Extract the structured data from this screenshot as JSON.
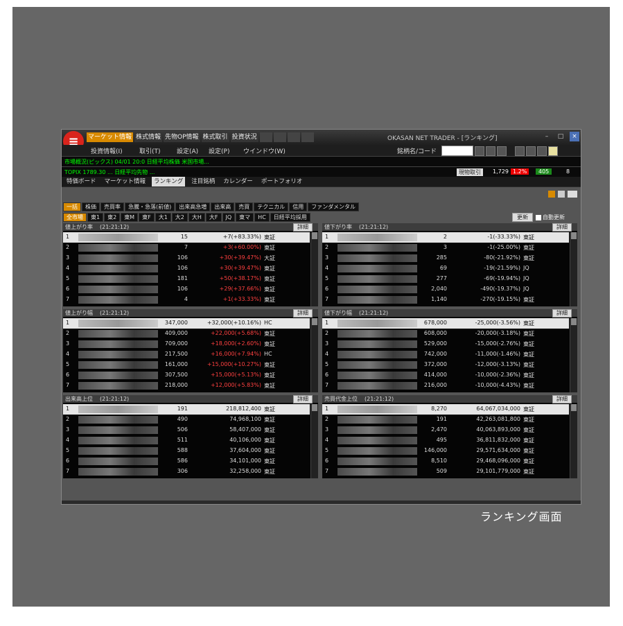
{
  "window": {
    "title": "OKASAN NET TRADER - [ランキング]"
  },
  "top_menu": [
    "マーケット情報",
    "株式情報",
    "先物OP情報",
    "株式取引",
    "投資状況"
  ],
  "menu_bar": [
    "投資情報(I)",
    "取引(T)",
    "設定(A)",
    "設定(P)",
    "ウインドウ(W)"
  ],
  "code_label": "銘柄名/コード",
  "ticker1": "市場概況(ピックス) 04/01 20:0 日経平均株価 米国市場...",
  "ticker2": "TOPIX 1789.30 ... 日経平均先物 ...",
  "status": {
    "kubun": "現物取引",
    "v1": "1,729",
    "v2": "1.2%",
    "v3": "405",
    "v4": "8"
  },
  "tabs": [
    "特価ボード",
    "マーケット情報",
    "ランキング",
    "注目銘柄",
    "カレンダー",
    "ポートフォリオ"
  ],
  "active_tab": "ランキング",
  "categories": [
    "一括",
    "株価",
    "売買率",
    "急騰・急落(前値)",
    "出来高急増",
    "出来高",
    "売買",
    "テクニカル",
    "信用",
    "ファンダメンタル"
  ],
  "markets": [
    "全市場",
    "東1",
    "東2",
    "東M",
    "東F",
    "大1",
    "大2",
    "大H",
    "大F",
    "JQ",
    "東マ",
    "HC",
    "日経平均採用"
  ],
  "update_label": "更新",
  "auto_label": "自動更新",
  "detail_label": "詳細",
  "panels": [
    {
      "title": "値上がり率",
      "time": "(21:21:12)",
      "rows": [
        {
          "rank": "1",
          "a": "15",
          "b": "+7(+83.33%)",
          "mkt": "東証"
        },
        {
          "rank": "2",
          "a": "7",
          "b": "+3(+60.00%)",
          "mkt": "東証"
        },
        {
          "rank": "3",
          "a": "106",
          "b": "+30(+39.47%)",
          "mkt": "大証"
        },
        {
          "rank": "4",
          "a": "106",
          "b": "+30(+39.47%)",
          "mkt": "東証"
        },
        {
          "rank": "5",
          "a": "181",
          "b": "+50(+38.17%)",
          "mkt": "東証"
        },
        {
          "rank": "6",
          "a": "106",
          "b": "+29(+37.66%)",
          "mkt": "東証"
        },
        {
          "rank": "7",
          "a": "4",
          "b": "+1(+33.33%)",
          "mkt": "東証"
        }
      ]
    },
    {
      "title": "値下がり率",
      "time": "(21:21:12)",
      "rows": [
        {
          "rank": "1",
          "a": "2",
          "b": "-1(-33.33%)",
          "mkt": "東証"
        },
        {
          "rank": "2",
          "a": "3",
          "b": "-1(-25.00%)",
          "mkt": "東証"
        },
        {
          "rank": "3",
          "a": "285",
          "b": "-80(-21.92%)",
          "mkt": "東証"
        },
        {
          "rank": "4",
          "a": "69",
          "b": "-19(-21.59%)",
          "mkt": "JQ"
        },
        {
          "rank": "5",
          "a": "277",
          "b": "-69(-19.94%)",
          "mkt": "JQ"
        },
        {
          "rank": "6",
          "a": "2,040",
          "b": "-490(-19.37%)",
          "mkt": "JQ"
        },
        {
          "rank": "7",
          "a": "1,140",
          "b": "-270(-19.15%)",
          "mkt": "東証"
        }
      ]
    },
    {
      "title": "値上がり幅",
      "time": "(21:21:12)",
      "rows": [
        {
          "rank": "1",
          "a": "347,000",
          "b": "+32,000(+10.16%)",
          "mkt": "HC"
        },
        {
          "rank": "2",
          "a": "409,000",
          "b": "+22,000(+5.68%)",
          "mkt": "東証"
        },
        {
          "rank": "3",
          "a": "709,000",
          "b": "+18,000(+2.60%)",
          "mkt": "東証"
        },
        {
          "rank": "4",
          "a": "217,500",
          "b": "+16,000(+7.94%)",
          "mkt": "HC"
        },
        {
          "rank": "5",
          "a": "161,000",
          "b": "+15,000(+10.27%)",
          "mkt": "東証"
        },
        {
          "rank": "6",
          "a": "307,500",
          "b": "+15,000(+5.13%)",
          "mkt": "東証"
        },
        {
          "rank": "7",
          "a": "218,000",
          "b": "+12,000(+5.83%)",
          "mkt": "東証"
        }
      ]
    },
    {
      "title": "値下がり幅",
      "time": "(21:21:12)",
      "rows": [
        {
          "rank": "1",
          "a": "678,000",
          "b": "-25,000(-3.56%)",
          "mkt": "東証"
        },
        {
          "rank": "2",
          "a": "608,000",
          "b": "-20,000(-3.18%)",
          "mkt": "東証"
        },
        {
          "rank": "3",
          "a": "529,000",
          "b": "-15,000(-2.76%)",
          "mkt": "東証"
        },
        {
          "rank": "4",
          "a": "742,000",
          "b": "-11,000(-1.46%)",
          "mkt": "東証"
        },
        {
          "rank": "5",
          "a": "372,000",
          "b": "-12,000(-3.13%)",
          "mkt": "東証"
        },
        {
          "rank": "6",
          "a": "414,000",
          "b": "-10,000(-2.36%)",
          "mkt": "東証"
        },
        {
          "rank": "7",
          "a": "216,000",
          "b": "-10,000(-4.43%)",
          "mkt": "東証"
        }
      ]
    },
    {
      "title": "出来高上位",
      "time": "(21:21:12)",
      "rows": [
        {
          "rank": "1",
          "a": "191",
          "b": "218,812,400",
          "mkt": "東証"
        },
        {
          "rank": "2",
          "a": "490",
          "b": "74,968,100",
          "mkt": "東証"
        },
        {
          "rank": "3",
          "a": "506",
          "b": "58,407,000",
          "mkt": "東証"
        },
        {
          "rank": "4",
          "a": "511",
          "b": "40,106,000",
          "mkt": "東証"
        },
        {
          "rank": "5",
          "a": "588",
          "b": "37,604,000",
          "mkt": "東証"
        },
        {
          "rank": "6",
          "a": "586",
          "b": "34,101,000",
          "mkt": "東証"
        },
        {
          "rank": "7",
          "a": "306",
          "b": "32,258,000",
          "mkt": "東証"
        }
      ]
    },
    {
      "title": "売買代金上位",
      "time": "(21:21:12)",
      "rows": [
        {
          "rank": "1",
          "a": "8,270",
          "b": "64,067,034,000",
          "mkt": "東証"
        },
        {
          "rank": "2",
          "a": "191",
          "b": "42,263,081,800",
          "mkt": "東証"
        },
        {
          "rank": "3",
          "a": "2,470",
          "b": "40,063,893,000",
          "mkt": "東証"
        },
        {
          "rank": "4",
          "a": "495",
          "b": "36,811,832,000",
          "mkt": "東証"
        },
        {
          "rank": "5",
          "a": "146,000",
          "b": "29,571,634,000",
          "mkt": "東証"
        },
        {
          "rank": "6",
          "a": "8,510",
          "b": "29,468,096,000",
          "mkt": "東証"
        },
        {
          "rank": "7",
          "a": "509",
          "b": "29,101,779,000",
          "mkt": "東証"
        }
      ]
    }
  ],
  "caption": "ランキング画面",
  "colors": {
    "accent": "#d88a00",
    "positive": "#ff4040",
    "ticker": "#00ff00"
  }
}
